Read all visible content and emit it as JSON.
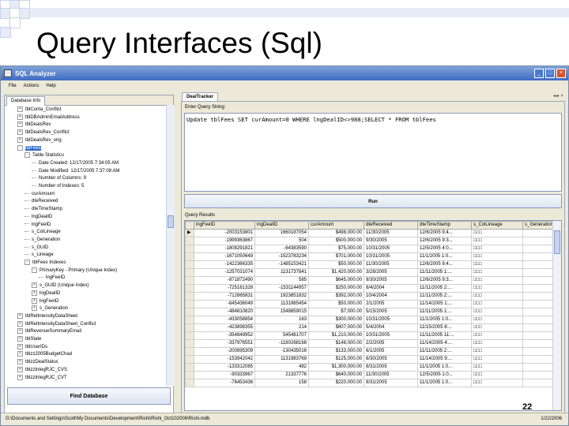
{
  "slide": {
    "title": "Query Interfaces (Sql)",
    "page_number": "22"
  },
  "window": {
    "title": "SQL Analyzer",
    "controls": [
      "_",
      "□",
      "×"
    ]
  },
  "menu": [
    "File",
    "Actions",
    "Help"
  ],
  "left_panel": {
    "tab": "Database Info",
    "tree": [
      {
        "indent": 0,
        "toggle": "+",
        "label": "tblConta_Conflict"
      },
      {
        "indent": 0,
        "toggle": "+",
        "label": "tblDBAdminEmailAddress"
      },
      {
        "indent": 0,
        "toggle": "+",
        "label": "tblDealsRev"
      },
      {
        "indent": 0,
        "toggle": "+",
        "label": "tblDealsRev_Conflict"
      },
      {
        "indent": 0,
        "toggle": "+",
        "label": "tblDealsRev_orig"
      },
      {
        "indent": 0,
        "toggle": "-",
        "label": "tblFees",
        "selected": true
      },
      {
        "indent": 1,
        "toggle": "-",
        "label": "Table Statistics"
      },
      {
        "indent": 2,
        "toggle": "",
        "label": "Date Created: 12/17/2005 7:34:05 AM"
      },
      {
        "indent": 2,
        "toggle": "",
        "label": "Date Modified: 12/17/2005 7:37:08 AM"
      },
      {
        "indent": 2,
        "toggle": "",
        "label": "Number of Columns: 9"
      },
      {
        "indent": 2,
        "toggle": "",
        "label": "Number of Indexes: 5"
      },
      {
        "indent": 1,
        "toggle": "",
        "label": "curAmount"
      },
      {
        "indent": 1,
        "toggle": "",
        "label": "dteReceived"
      },
      {
        "indent": 1,
        "toggle": "",
        "label": "dteTimeStamp"
      },
      {
        "indent": 1,
        "toggle": "",
        "label": "lngDealID"
      },
      {
        "indent": 1,
        "toggle": "",
        "label": "lngFeeID"
      },
      {
        "indent": 1,
        "toggle": "",
        "label": "s_ColLineage"
      },
      {
        "indent": 1,
        "toggle": "",
        "label": "s_Generation"
      },
      {
        "indent": 1,
        "toggle": "",
        "label": "s_GUID"
      },
      {
        "indent": 1,
        "toggle": "",
        "label": "s_Lineage"
      },
      {
        "indent": 1,
        "toggle": "-",
        "label": "tblFees Indexes"
      },
      {
        "indent": 2,
        "toggle": "-",
        "label": "PrimaryKey - Primary (Unique Index)"
      },
      {
        "indent": 3,
        "toggle": "",
        "label": "lngFeeID"
      },
      {
        "indent": 2,
        "toggle": "+",
        "label": "s_GUID (Unique Index)"
      },
      {
        "indent": 2,
        "toggle": "+",
        "label": "lngDealID"
      },
      {
        "indent": 2,
        "toggle": "+",
        "label": "lngFeeID"
      },
      {
        "indent": 2,
        "toggle": "+",
        "label": "s_Generation"
      },
      {
        "indent": 0,
        "toggle": "+",
        "label": "tblRelIntensityDataSheet"
      },
      {
        "indent": 0,
        "toggle": "+",
        "label": "tblRelIntensityDataSheet_Conflict"
      },
      {
        "indent": 0,
        "toggle": "+",
        "label": "tblRevenueSummaryEmail"
      },
      {
        "indent": 0,
        "toggle": "+",
        "label": "tblState"
      },
      {
        "indent": 0,
        "toggle": "+",
        "label": "tblUserIDs"
      },
      {
        "indent": 0,
        "toggle": "+",
        "label": "tblzz2005BudgetChad"
      },
      {
        "indent": 0,
        "toggle": "+",
        "label": "tblzzDealStatus"
      },
      {
        "indent": 0,
        "toggle": "+",
        "label": "tblzzIntegRJC_CVS"
      },
      {
        "indent": 0,
        "toggle": "+",
        "label": "tblzzIntegRJC_CVT"
      }
    ],
    "find_button": "Find Database"
  },
  "right_panel": {
    "doc_tab": "DealTracker",
    "doc_controls": "◂ ▸ ×",
    "query_label": "Enter Query String:",
    "query": "Update tblFees SET curAmount=0 WHERE lngDealID<>988;SELECT * FROM tblFees",
    "run_button": "Run",
    "results_label": "Query Results",
    "columns": [
      "lngFeeID",
      "lngDealID",
      "curAmount",
      "dteReceived",
      "dteTimeStamp",
      "s_ColLineage",
      "s_Generation"
    ],
    "rows": [
      [
        "-2003153801",
        "1660187054",
        "$498,000.00",
        "11/30/2005",
        "12/6/2005 9:4...",
        "□□□",
        ""
      ],
      [
        "-1999363867",
        "504",
        "$500,000.00",
        "9/30/2005",
        "12/6/2005 9:3...",
        "□□□",
        ""
      ],
      [
        "-1808291821",
        "-64383590",
        "$75,000.00",
        "10/31/2005",
        "12/5/2005 4:0...",
        "□□□",
        ""
      ],
      [
        "-1671050649",
        "-1523783234",
        "$701,000.00",
        "10/31/2005",
        "11/1/2005 1:0...",
        "□□□",
        ""
      ],
      [
        "-1422366335",
        "-1485153421",
        "$50,000.00",
        "11/30/2005",
        "12/6/2005 9:4...",
        "□□□",
        ""
      ],
      [
        "-1257031074",
        "1131737841",
        "$1,420,000.00",
        "3/28/2005",
        "11/11/2005 1:...",
        "□□□",
        ""
      ],
      [
        "-871872490",
        "585",
        "$645,000.00",
        "9/30/2005",
        "12/6/2005 9:3...",
        "□□□",
        ""
      ],
      [
        "-725161328",
        "-1531144957",
        "$250,000.00",
        "8/4/2004",
        "11/11/2005 2:...",
        "□□□",
        ""
      ],
      [
        "-712865831",
        "1923851832",
        "$392,000.00",
        "10/4/2004",
        "11/11/2005 2:...",
        "□□□",
        ""
      ],
      [
        "-645436049",
        "1131985454",
        "$50,000.00",
        "2/1/2005",
        "11/14/2005 1:...",
        "□□□",
        ""
      ],
      [
        "-484810820",
        "1548859015",
        "$7,000.00",
        "5/15/2005",
        "11/11/2005 1:...",
        "□□□",
        ""
      ],
      [
        "-433058854",
        "163",
        "$300,000.00",
        "10/31/2005",
        "11/1/2005 1:0...",
        "□□□",
        ""
      ],
      [
        "-423898355",
        "214",
        "$607,000.00",
        "5/4/2004",
        "11/15/2005 8:...",
        "□□□",
        ""
      ],
      [
        "-354849952",
        "545481707",
        "$1,210,000.00",
        "10/31/2005",
        "11/11/2005 11:...",
        "□□□",
        ""
      ],
      [
        "-337976551",
        "-1160268168",
        "$148,000.00",
        "2/2/2005",
        "11/14/2005 4:...",
        "□□□",
        ""
      ],
      [
        "-200895309",
        "-130435016",
        "$133,000.00",
        "6/1/2005",
        "11/11/2005 2:...",
        "□□□",
        ""
      ],
      [
        "-153942042",
        "1131983769",
        "$125,000.00",
        "6/30/2005",
        "11/14/2005 9:...",
        "□□□",
        ""
      ],
      [
        "-133312085",
        "482",
        "$1,300,000.00",
        "8/31/2005",
        "11/1/2005 1:0...",
        "□□□",
        ""
      ],
      [
        "-90333967",
        "21337776",
        "$640,000.00",
        "11/30/2005",
        "12/5/2005 1:0...",
        "□□□",
        ""
      ],
      [
        "-76453436",
        "158",
        "$220,000.00",
        "8/31/2005",
        "11/1/2005 1:0...",
        "□□□",
        ""
      ]
    ]
  },
  "status": {
    "path": "G:\\Documents and Settings\\Scott\\My Documents\\Development\\Rishi\\Rishi_Oct102006\\Rishi.mdb",
    "date": "1/22/2006"
  },
  "colors": {
    "titlebar": "#3f6cc4",
    "chrome": "#ece9d8",
    "deco": "#e6ebf7"
  }
}
